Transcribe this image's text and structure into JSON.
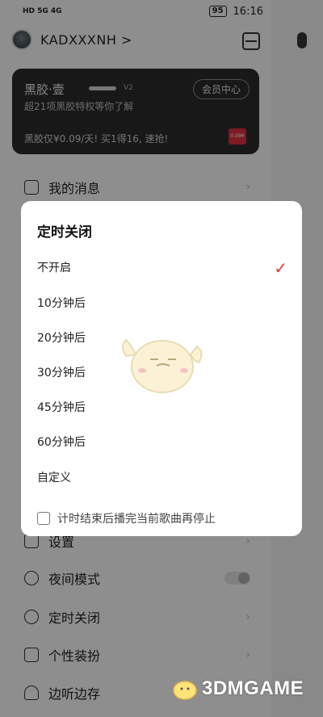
{
  "status_bar": {
    "network": "HD 5G 4G",
    "battery": "95",
    "time": "16:16"
  },
  "header": {
    "username": "KADXXXNH >"
  },
  "vip_card": {
    "title": "黑胶·壹",
    "level": "V2",
    "center_button": "会员中心",
    "subtitle": "超21项黑胶特权等你了解",
    "promo": "黑胶仅¥0.09/天! 买1得16, 速抢!",
    "badge": "0.09¥"
  },
  "menu": {
    "messages": "我的消息",
    "settings": "设置",
    "night_mode": "夜间模式",
    "timer": "定时关闭",
    "theme": "个性装扮",
    "listen_save": "边听边存"
  },
  "dialog": {
    "title": "定时关闭",
    "options": [
      {
        "label": "不开启",
        "selected": true
      },
      {
        "label": "10分钟后",
        "selected": false
      },
      {
        "label": "20分钟后",
        "selected": false
      },
      {
        "label": "30分钟后",
        "selected": false
      },
      {
        "label": "45分钟后",
        "selected": false
      },
      {
        "label": "60分钟后",
        "selected": false
      },
      {
        "label": "自定义",
        "selected": false
      }
    ],
    "check_mark": "✓",
    "footer_checkbox_label": "计时结束后播完当前歌曲再停止"
  },
  "watermark": {
    "text": "3DMGAME"
  },
  "colors": {
    "accent": "#e33333",
    "overlay": "rgba(0,0,0,0.42)"
  }
}
